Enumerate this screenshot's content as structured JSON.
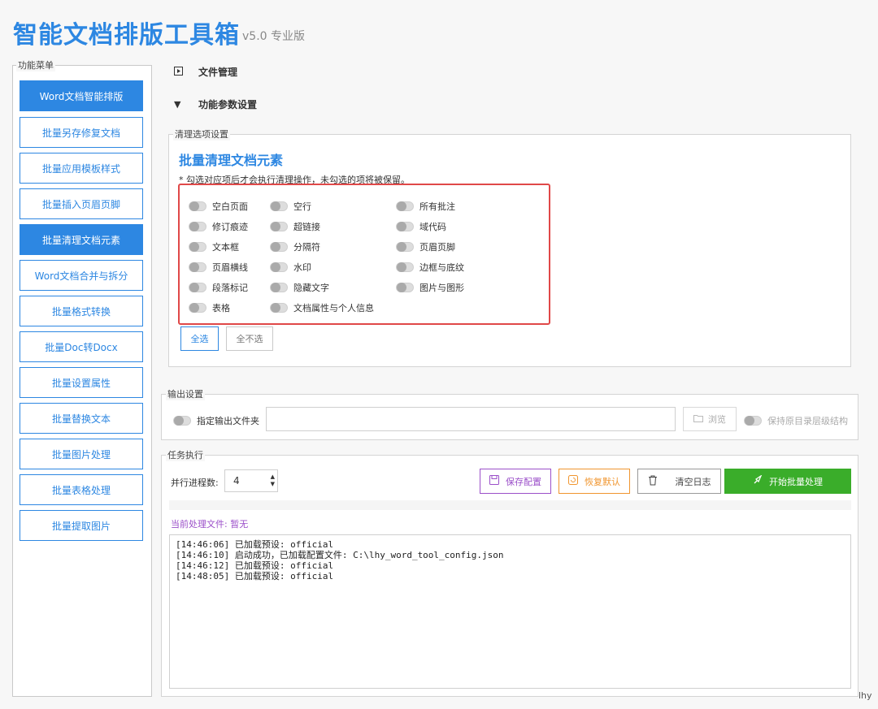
{
  "app": {
    "title": "智能文档排版工具箱",
    "version": "v5.0 专业版"
  },
  "menu": {
    "title": "功能菜单",
    "items": [
      {
        "label": "Word文档智能排版",
        "active": true
      },
      {
        "label": "批量另存修复文档",
        "active": false
      },
      {
        "label": "批量应用模板样式",
        "active": false
      },
      {
        "label": "批量插入页眉页脚",
        "active": false
      },
      {
        "label": "批量清理文档元素",
        "active": true
      },
      {
        "label": "Word文档合并与拆分",
        "active": false
      },
      {
        "label": "批量格式转换",
        "active": false
      },
      {
        "label": "批量Doc转Docx",
        "active": false
      },
      {
        "label": "批量设置属性",
        "active": false
      },
      {
        "label": "批量替换文本",
        "active": false
      },
      {
        "label": "批量图片处理",
        "active": false
      },
      {
        "label": "批量表格处理",
        "active": false
      },
      {
        "label": "批量提取图片",
        "active": false
      }
    ]
  },
  "sections": {
    "file_manage": "文件管理",
    "params": "功能参数设置"
  },
  "clean": {
    "group_title": "清理选项设置",
    "title": "批量清理文档元素",
    "note": "* 勾选对应项后才会执行清理操作，未勾选的项将被保留。",
    "col1": [
      "空白页面",
      "修订痕迹",
      "文本框",
      "页眉横线",
      "段落标记",
      "表格"
    ],
    "col2": [
      "空行",
      "超链接",
      "分隔符",
      "水印",
      "隐藏文字",
      "文档属性与个人信息"
    ],
    "col3": [
      "所有批注",
      "域代码",
      "页眉页脚",
      "边框与底纹",
      "图片与图形"
    ],
    "select_all": "全选",
    "select_none": "全不选"
  },
  "output": {
    "group_title": "输出设置",
    "toggle_label": "指定输出文件夹",
    "path_value": "",
    "browse": "浏览",
    "keep_structure": "保持原目录层级结构"
  },
  "task": {
    "group_title": "任务执行",
    "parallel_label": "并行进程数:",
    "parallel_value": "4",
    "save_config": "保存配置",
    "restore_default": "恢复默认",
    "clear_log": "清空日志",
    "start": "开始批量处理",
    "current_file": "当前处理文件: 暂无",
    "log": [
      "[14:46:06] 已加载预设: official",
      "[14:46:10] 启动成功，已加载配置文件: C:\\lhy_word_tool_config.json",
      "[14:46:12] 已加载预设: official",
      "[14:48:05] 已加载预设: official"
    ]
  },
  "corner_text": "lhy"
}
